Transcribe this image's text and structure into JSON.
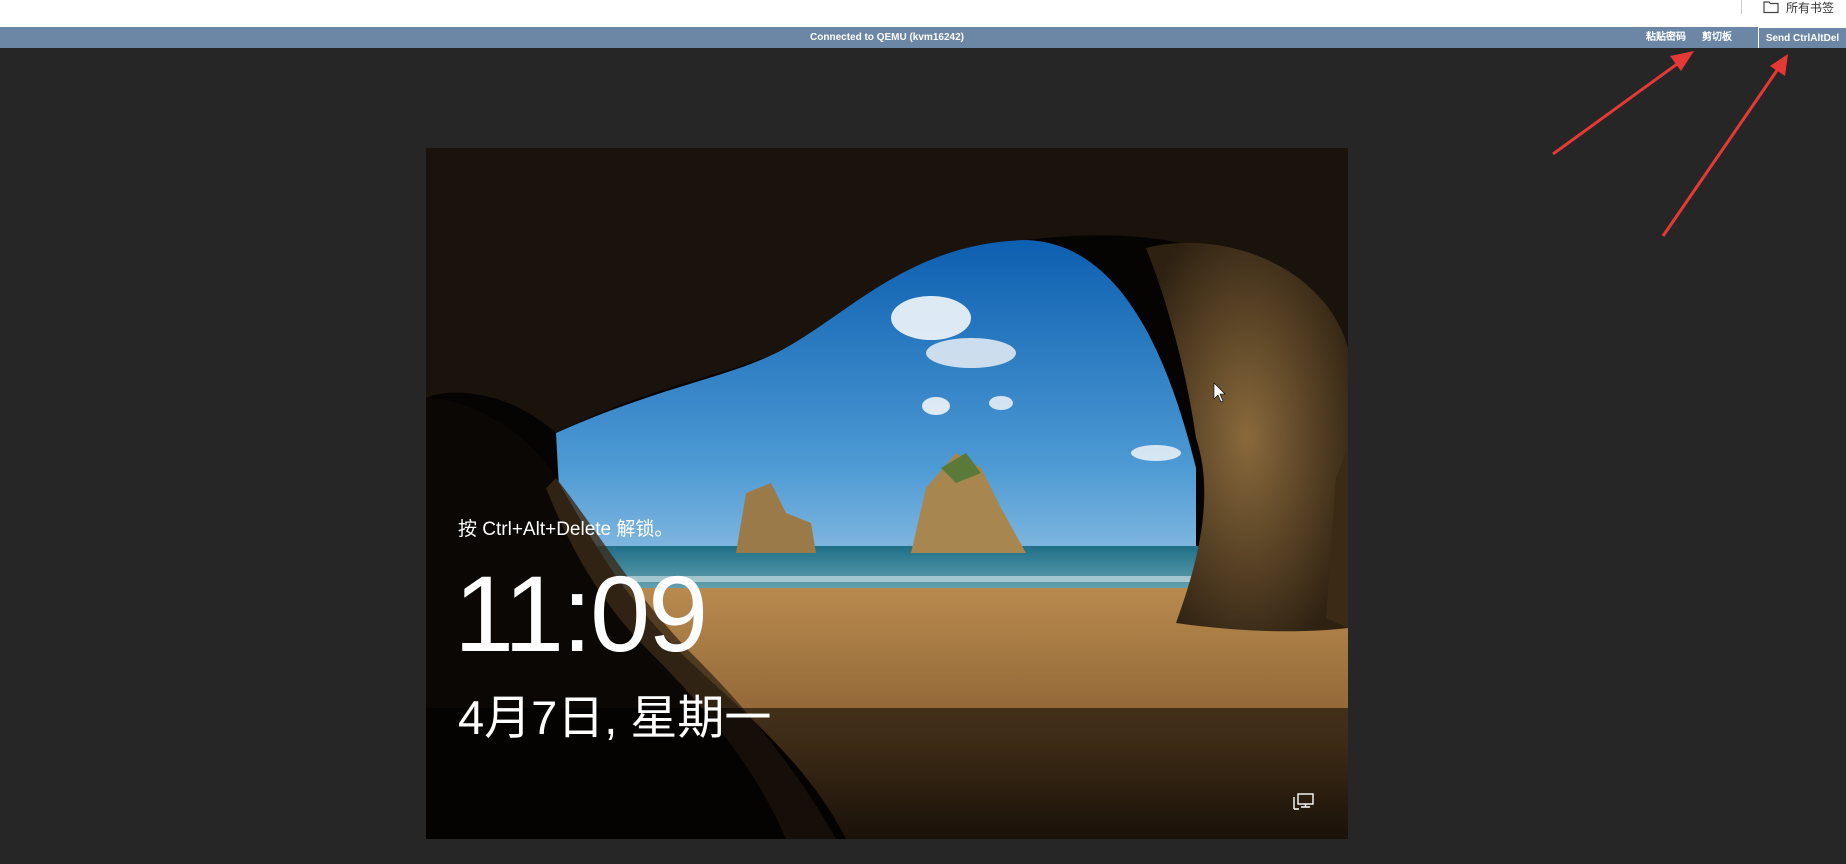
{
  "browser": {
    "bookmarks_label": "所有书签",
    "folder_icon": "folder-icon"
  },
  "vnc_toolbar": {
    "status": "Connected to QEMU (kvm16242)",
    "paste_password": "粘贴密码",
    "clipboard": "剪切板",
    "send_ctrl_alt_del": "Send CtrlAltDel",
    "bar_color": "#6c86a6"
  },
  "lock_screen": {
    "unlock_hint": "按 Ctrl+Alt+Delete 解锁。",
    "time": "11:09",
    "date": "4月7日, 星期一",
    "network_icon": "network-icon",
    "background": "cave-beach-wallpaper"
  },
  "annotations": {
    "arrow_color": "#e53935"
  }
}
